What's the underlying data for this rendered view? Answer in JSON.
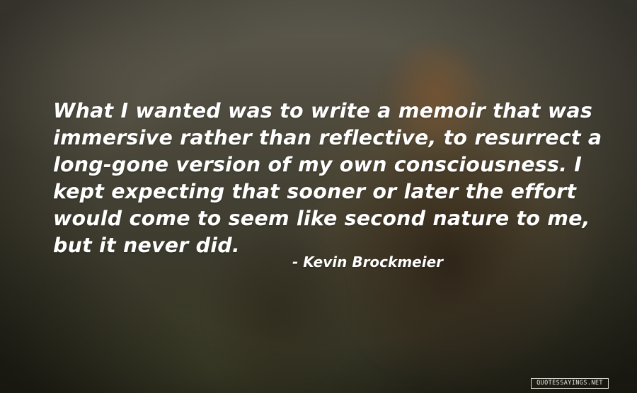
{
  "quote": {
    "lines": [
      "What I wanted was to write a memoir that was",
      "immersive rather than reflective, to resurrect a",
      "long-gone version of my own consciousness. I",
      "kept expecting that sooner or later the effort",
      "would come to seem like second nature to me,",
      "but it never did."
    ],
    "author": "- Kevin Brockmeier"
  },
  "watermark": "QUOTESSAYINGS.NET",
  "colors": {
    "text": "#ffffff",
    "background_dark": "#2a2a1d",
    "background_mid": "#4b483b"
  }
}
